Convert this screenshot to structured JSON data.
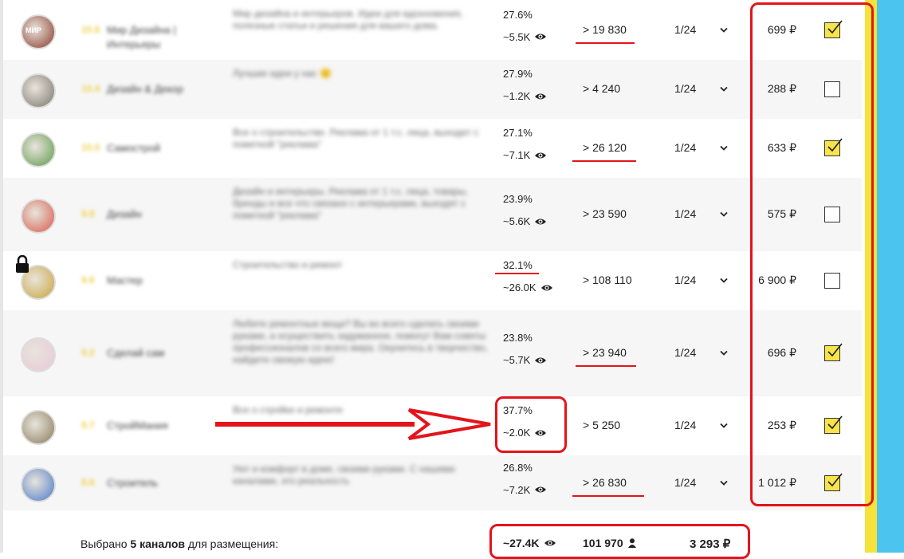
{
  "rows": [
    {
      "rating": "10.6",
      "name": "Мир Дизайна | Интерьеры",
      "desc": "Мир дизайна и интерьеров. Идеи для вдохновения, полезные статьи и решения для вашего дома.",
      "er": "27.6%",
      "views": "~5.5K",
      "subs": "> 19 830",
      "freq": "1/24",
      "price": "699 ₽",
      "checked": true,
      "avatar_color": "#8a3a2a",
      "avatar_text": "МИР"
    },
    {
      "rating": "10.4",
      "name": "Дизайн & Декор",
      "desc": "Лучшие идеи у нас 🙂",
      "er": "27.9%",
      "views": "~1.2K",
      "subs": "> 4 240",
      "freq": "1/24",
      "price": "288 ₽",
      "checked": false,
      "avatar_color": "#7c766c",
      "avatar_text": ""
    },
    {
      "rating": "10.0",
      "name": "Самострой",
      "desc": "Все о строительстве. Реклама от 1 т.с. лица, выходит с пометкой \"реклама\"",
      "er": "27.1%",
      "views": "~7.1K",
      "subs": "> 26 120",
      "freq": "1/24",
      "price": "633 ₽",
      "checked": true,
      "avatar_color": "#5f9a4a",
      "avatar_text": ""
    },
    {
      "rating": "9.8",
      "name": "Дизайн",
      "desc": "Дизайн и интерьеры. Реклама от 1 т.с. лица, товары, бренды и все что связано с интерьерами, выходят с пометкой \"реклама\"",
      "er": "23.9%",
      "views": "~5.6K",
      "subs": "> 23 590",
      "freq": "1/24",
      "price": "575 ₽",
      "checked": false,
      "avatar_color": "#d85a4a",
      "avatar_text": ""
    },
    {
      "rating": "9.6",
      "name": "Мастер",
      "desc": "Строительство и ремонт",
      "er": "32.1%",
      "views": "~26.0K",
      "subs": "> 108 110",
      "freq": "1/24",
      "price": "6 900 ₽",
      "checked": false,
      "avatar_color": "#c9a43a",
      "avatar_text": ""
    },
    {
      "rating": "9.2",
      "name": "Сделай сам",
      "desc": "Любите ремонтные вещи? Вы во всего сделать своими руками, а осуществить задуманное, помогут Вам советы профессионалов со всего мира. Окунитесь в творчество, найдите свежую идею!",
      "er": "23.8%",
      "views": "~5.7K",
      "subs": "> 23 940",
      "freq": "1/24",
      "price": "696 ₽",
      "checked": true,
      "avatar_color": "#e8c8d8",
      "avatar_text": ""
    },
    {
      "rating": "8.7",
      "name": "СтройМания",
      "desc": "Все о стройке и ремонте",
      "er": "37.7%",
      "views": "~2.0K",
      "subs": "> 5 250",
      "freq": "1/24",
      "price": "253 ₽",
      "checked": true,
      "avatar_color": "#8a7a5a",
      "avatar_text": ""
    },
    {
      "rating": "8.6",
      "name": "Строитель",
      "desc": "Уют и комфорт в доме, своими руками. С нашими каналами, это реальность",
      "er": "26.8%",
      "views": "~7.2K",
      "subs": "> 26 830",
      "freq": "1/24",
      "price": "1 012 ₽",
      "checked": true,
      "avatar_color": "#4a7ac8",
      "avatar_text": ""
    }
  ],
  "footer": {
    "selected_prefix": "Выбрано ",
    "selected_count": "5 каналов",
    "selected_suffix": " для размещения:",
    "total_views": "~27.4K",
    "total_subs": "101 970",
    "total_price": "3 293 ₽"
  },
  "colors": {
    "accent_red": "#e3141b",
    "checkbox_yellow": "#f7e34a",
    "side_blue": "#4bc4f0",
    "side_yellow": "#f5e33c"
  },
  "icons": {
    "eye": "eye-icon",
    "chevron": "chevron-down-icon",
    "lock": "lock-icon",
    "user": "user-icon",
    "check": "checkmark-icon"
  }
}
